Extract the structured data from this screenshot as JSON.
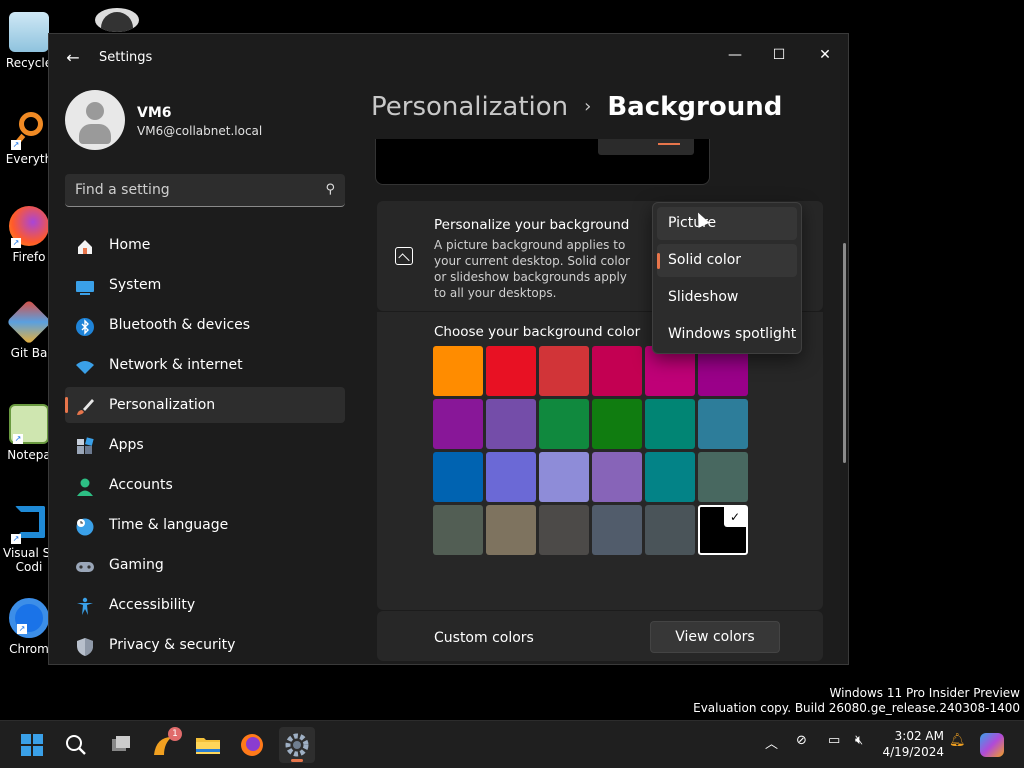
{
  "desktop": {
    "icons": [
      {
        "label": "Recycle"
      },
      {
        "label": "Everyth"
      },
      {
        "label": "Firefo"
      },
      {
        "label": "Git Ba"
      },
      {
        "label": "Notepa"
      },
      {
        "label": "Visual St"
      },
      {
        "label": "Codi"
      },
      {
        "label": "Chrom"
      }
    ]
  },
  "window": {
    "app_title": "Settings",
    "controls": {
      "minimize": "—",
      "maximize": "☐",
      "close": "✕"
    }
  },
  "profile": {
    "name": "VM6",
    "email": "VM6@collabnet.local"
  },
  "search": {
    "placeholder": "Find a setting"
  },
  "nav": {
    "items": [
      {
        "label": "Home"
      },
      {
        "label": "System"
      },
      {
        "label": "Bluetooth & devices"
      },
      {
        "label": "Network & internet"
      },
      {
        "label": "Personalization",
        "active": true
      },
      {
        "label": "Apps"
      },
      {
        "label": "Accounts"
      },
      {
        "label": "Time & language"
      },
      {
        "label": "Gaming"
      },
      {
        "label": "Accessibility"
      },
      {
        "label": "Privacy & security"
      }
    ]
  },
  "breadcrumb": {
    "parent": "Personalization",
    "separator": "›",
    "current": "Background"
  },
  "background_card": {
    "title": "Personalize your background",
    "description": "A picture background applies to your current desktop. Solid color or slideshow backgrounds apply to all your desktops."
  },
  "dropdown": {
    "options": [
      "Picture",
      "Solid color",
      "Slideshow",
      "Windows spotlight"
    ],
    "selected": "Solid color",
    "hovered": "Picture"
  },
  "colors_section": {
    "title": "Choose your background color",
    "swatches": [
      "#FF8C00",
      "#E81123",
      "#D13438",
      "#C30052",
      "#BF0077",
      "#9A0089",
      "#881798",
      "#744DA9",
      "#10893E",
      "#107C10",
      "#018574",
      "#2D7D9A",
      "#0063B1",
      "#6B69D6",
      "#8E8CD8",
      "#8764B8",
      "#038387",
      "#486860",
      "#525E54",
      "#7E735F",
      "#4C4A48",
      "#515C6B",
      "#4A5459",
      "#000000"
    ],
    "selected_index": 23
  },
  "custom_colors": {
    "label": "Custom colors",
    "button": "View colors"
  },
  "watermark": {
    "line1": "Windows 11 Pro Insider Preview",
    "line2": "Evaluation copy. Build 26080.ge_release.240308-1400"
  },
  "taskbar": {
    "time": "3:02 AM",
    "date": "4/19/2024",
    "notification_count": "1"
  },
  "accent": "#E7754B"
}
